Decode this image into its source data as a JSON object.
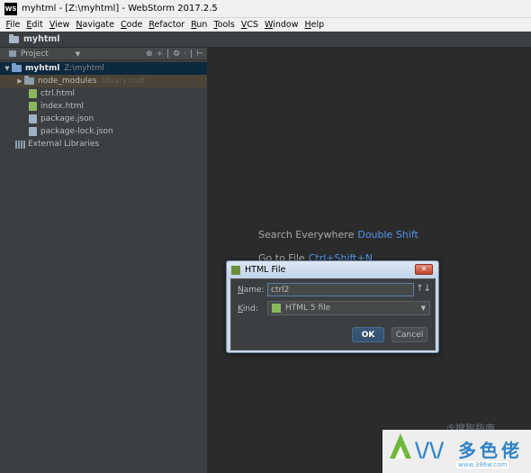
{
  "window": {
    "logo_text": "WS",
    "title": "myhtml - [Z:\\myhtml] - WebStorm 2017.2.5"
  },
  "menu": [
    {
      "hot": "F",
      "rest": "ile"
    },
    {
      "hot": "E",
      "rest": "dit"
    },
    {
      "hot": "V",
      "rest": "iew"
    },
    {
      "hot": "N",
      "rest": "avigate"
    },
    {
      "hot": "C",
      "rest": "ode"
    },
    {
      "hot": "R",
      "rest": "efactor"
    },
    {
      "hot": "R",
      "rest": "un"
    },
    {
      "hot": "T",
      "rest": "ools"
    },
    {
      "hot": "V",
      "rest": "CS"
    },
    {
      "hot": "W",
      "rest": "indow"
    },
    {
      "hot": "H",
      "rest": "elp"
    }
  ],
  "navbar": {
    "label": "myhtml"
  },
  "project_panel": {
    "title": "Project",
    "dropdown_glyph": "▼",
    "tools": [
      "⊕",
      "÷",
      "|",
      "⚙",
      "·",
      "|",
      "⊢"
    ],
    "tree": {
      "root": {
        "name": "myhtml",
        "path": "Z:\\myhtml",
        "arrow": "▼"
      },
      "node_modules": {
        "name": "node_modules",
        "note": "library root",
        "arrow": "▶"
      },
      "files": [
        {
          "name": "ctrl.html",
          "kind": "html"
        },
        {
          "name": "index.html",
          "kind": "html"
        },
        {
          "name": "package.json",
          "kind": "json"
        },
        {
          "name": "package-lock.json",
          "kind": "json"
        }
      ],
      "external": {
        "name": "External Libraries"
      }
    }
  },
  "editor": {
    "hints": [
      {
        "text": "Search Everywhere",
        "key": "Double Shift"
      },
      {
        "text": "Go to File",
        "key": "Ctrl+Shift+N"
      }
    ]
  },
  "dialog": {
    "title": "HTML File",
    "close_glyph": "✕",
    "name_label": {
      "hot": "N",
      "rest": "ame:"
    },
    "name_value": "ctrl2",
    "sort_glyph": "↑↓",
    "kind_label": {
      "hot": "K",
      "rest": "ind:"
    },
    "kind_value": "HTML 5 file",
    "kind_drop_glyph": "▼",
    "ok": "OK",
    "cancel": "Cancel"
  },
  "watermarks": {
    "sogou": "⑤搜狗指南",
    "logo_text": "\\/\\/ 多 色 佬",
    "domain": "www.386w.com"
  },
  "colors": {
    "accent_key": "#5394ec",
    "selection": "#0d293e",
    "ok_button": "#3b5877"
  }
}
